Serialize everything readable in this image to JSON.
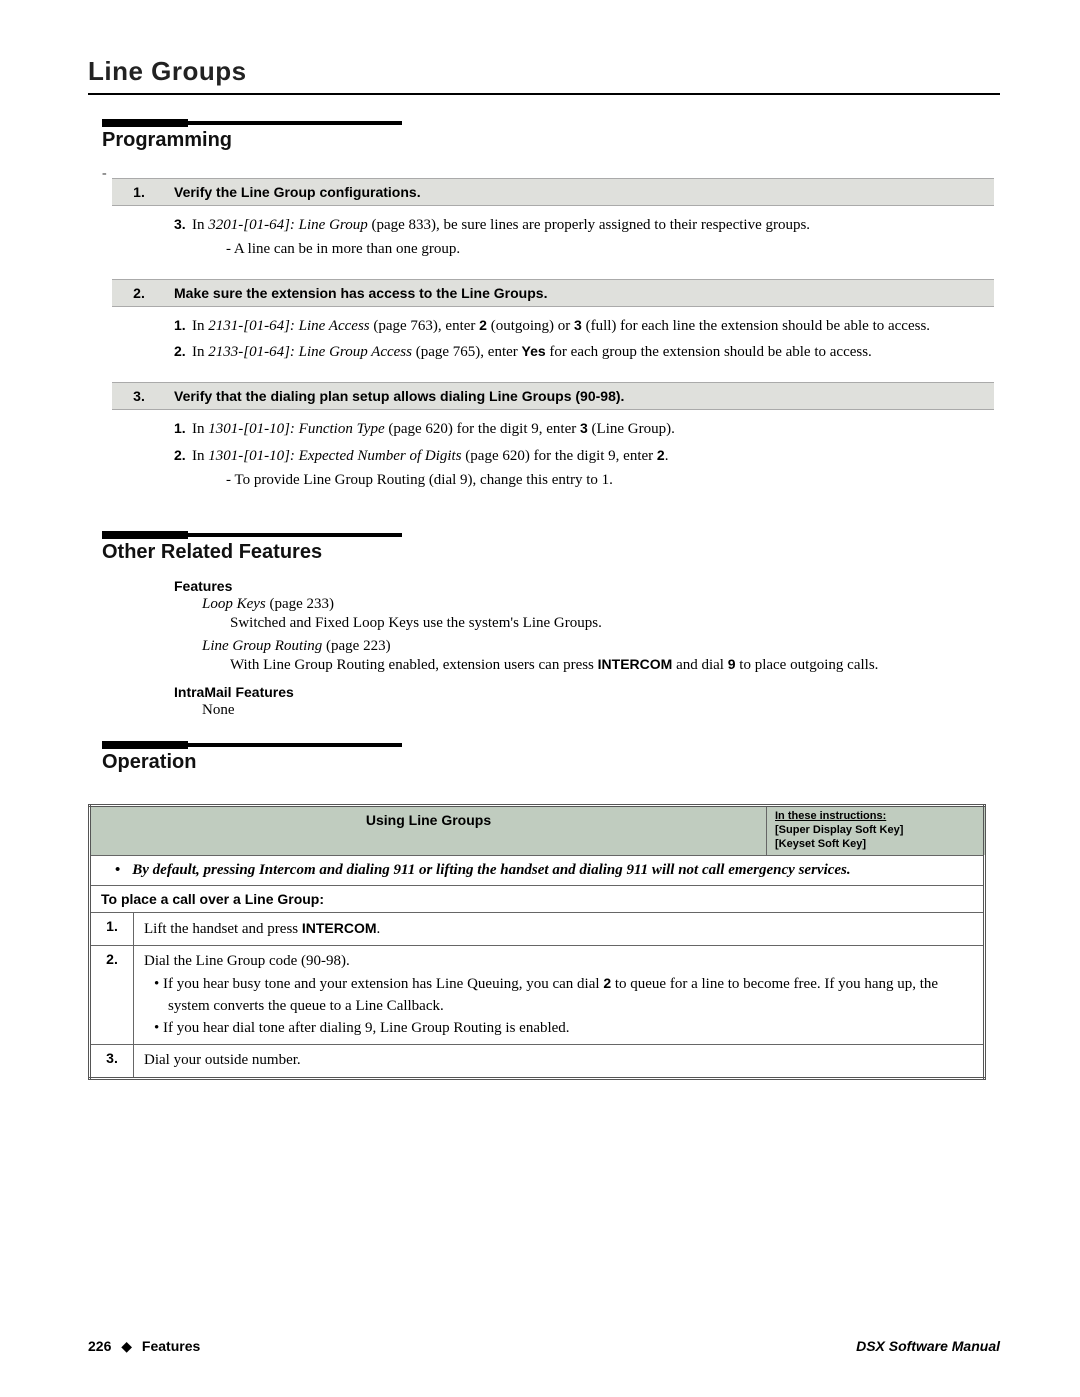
{
  "page_title": "Line Groups",
  "sections": {
    "programming": {
      "title": "Programming",
      "steps": [
        {
          "num": "1.",
          "heading": "Verify the Line Group configurations.",
          "items": [
            {
              "n": "3.",
              "prefix": "In ",
              "ref": "3201-[01-64]: Line Group",
              "page": " (page 833), be sure lines are properly assigned to their respective groups.",
              "sub": "-   A line can be in more than one group."
            }
          ]
        },
        {
          "num": "2.",
          "heading": "Make sure the extension has access to the Line Groups.",
          "items": [
            {
              "n": "1.",
              "prefix": "In ",
              "ref": "2131-[01-64]: Line Access",
              "page": " (page 763), enter ",
              "bold1": "2",
              "mid1": " (outgoing) or ",
              "bold2": "3",
              "tail": " (full) for each line the extension should be able to access."
            },
            {
              "n": "2.",
              "prefix": "In ",
              "ref": "2133-[01-64]: Line Group Access",
              "page": " (page 765), enter ",
              "bold1": "Yes",
              "tail": " for each group the extension should be able to access."
            }
          ]
        },
        {
          "num": "3.",
          "heading": "Verify that the dialing plan setup allows dialing Line Groups (90-98).",
          "items": [
            {
              "n": "1.",
              "prefix": "In ",
              "ref": "1301-[01-10]: Function Type",
              "page": " (page 620) for the digit 9, enter ",
              "bold1": "3",
              "tail": " (Line Group)."
            },
            {
              "n": "2.",
              "prefix": "In ",
              "ref": "1301-[01-10]: Expected Number of Digits",
              "page": " (page 620) for the digit 9, enter ",
              "bold1": "2",
              "tail": ".",
              "sub": "-   To provide Line Group Routing (dial 9), change this entry to 1."
            }
          ]
        }
      ]
    },
    "other": {
      "title": "Other Related Features",
      "features_label": "Features",
      "features": [
        {
          "title": "Loop Keys",
          "page": " (page 233)",
          "body": "Switched and Fixed Loop Keys use the system's Line Groups."
        },
        {
          "title": "Line Group Routing",
          "page": " (page 223)",
          "body_pre": "With Line Group Routing enabled, extension users can press ",
          "body_bold": "INTERCOM",
          "body_mid": " and dial ",
          "body_bold2": "9",
          "body_post": " to place outgoing calls."
        }
      ],
      "intramail_label": "IntraMail Features",
      "intramail_value": "None"
    },
    "operation": {
      "title": "Operation",
      "table": {
        "header_title": "Using Line Groups",
        "header_note_l1": "In these instructions:",
        "header_note_l2": "[Super Display Soft Key]",
        "header_note_l3": "[Keyset Soft Key]",
        "warning": "By default, pressing Intercom and dialing 911 or lifting the handset and dialing 911 will not call emergency services.",
        "sub_heading": "To place a call over a Line Group:",
        "rows": [
          {
            "num": "1.",
            "body_pre": "Lift the handset and press ",
            "body_bold": "INTERCOM",
            "body_post": "."
          },
          {
            "num": "2.",
            "body_line1": "Dial the Line Group code (90-98).",
            "bullet1_pre": "•  If you hear busy tone and your extension has Line Queuing, you can dial ",
            "bullet1_bold": "2",
            "bullet1_post": " to queue for a line to become free. If you hang up, the system converts the queue to a Line Callback.",
            "bullet2": "•  If you hear dial tone after dialing 9, Line Group Routing is enabled."
          },
          {
            "num": "3.",
            "body": "Dial your outside number."
          }
        ]
      }
    }
  },
  "footer": {
    "page_num": "226",
    "section": "Features",
    "manual": "DSX Software Manual"
  }
}
